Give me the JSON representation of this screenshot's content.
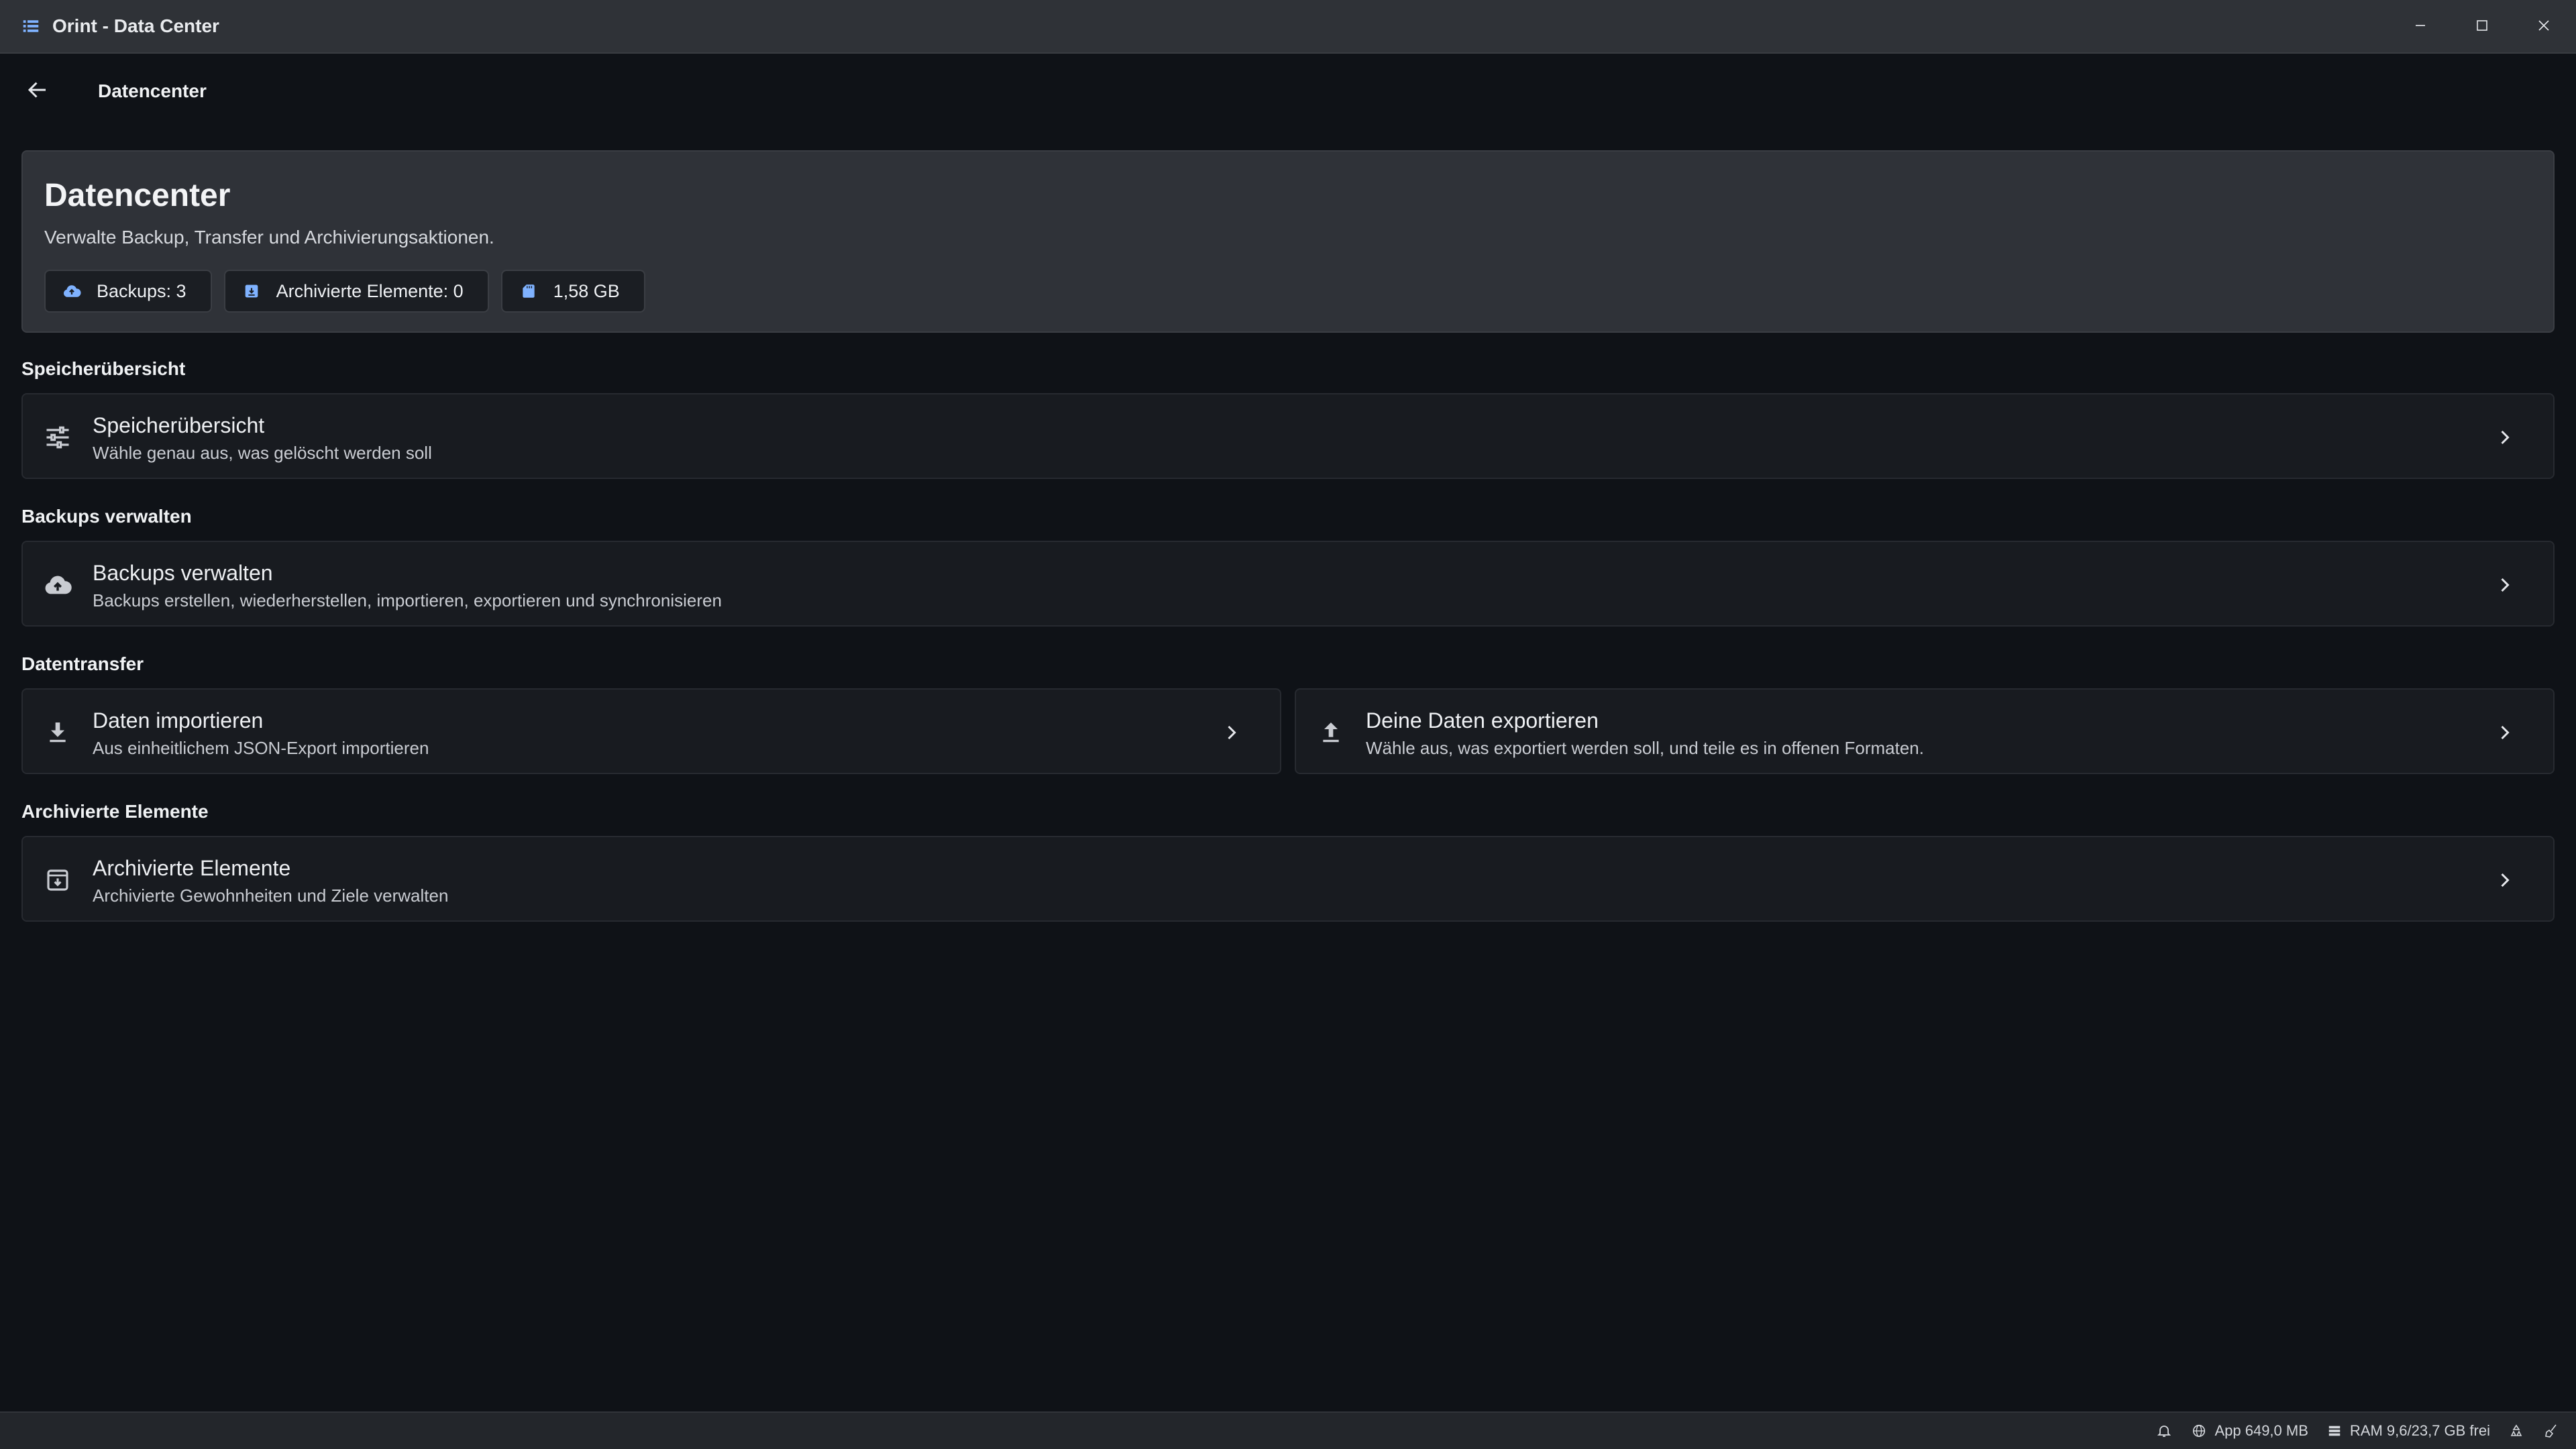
{
  "window": {
    "title": "Orint - Data Center",
    "icons": {
      "app": "list-icon",
      "minimize": "minimize-icon",
      "maximize": "maximize-icon",
      "close": "close-icon"
    }
  },
  "header": {
    "title": "Datencenter",
    "back_icon": "arrow-left-icon"
  },
  "hero": {
    "title": "Datencenter",
    "subtitle": "Verwalte Backup, Transfer und Archivierungsaktionen.",
    "chips": [
      {
        "icon": "cloud-upload-icon",
        "label": "Backups: 3"
      },
      {
        "icon": "archive-icon",
        "label": "Archivierte Elemente: 0"
      },
      {
        "icon": "sd-card-icon",
        "label": "1,58 GB"
      }
    ]
  },
  "sections": {
    "storage": {
      "label": "Speicherübersicht",
      "card": {
        "icon": "sliders-icon",
        "title": "Speicherübersicht",
        "subtitle": "Wähle genau aus, was gelöscht werden soll"
      }
    },
    "backups": {
      "label": "Backups verwalten",
      "card": {
        "icon": "cloud-upload-icon",
        "title": "Backups verwalten",
        "subtitle": "Backups erstellen, wiederherstellen, importieren, exportieren und synchronisieren"
      }
    },
    "transfer": {
      "label": "Datentransfer",
      "import": {
        "icon": "download-icon",
        "title": "Daten importieren",
        "subtitle": "Aus einheitlichem JSON-Export importieren"
      },
      "export": {
        "icon": "upload-icon",
        "title": "Deine Daten exportieren",
        "subtitle": "Wähle aus, was exportiert werden soll, und teile es in offenen Formaten."
      }
    },
    "archived": {
      "label": "Archivierte Elemente",
      "card": {
        "icon": "archive-icon",
        "title": "Archivierte Elemente",
        "subtitle": "Archivierte Gewohnheiten und Ziele verwalten"
      }
    }
  },
  "statusbar": {
    "app_mem": "App 649,0 MB",
    "ram": "RAM 9,6/23,7 GB frei",
    "icons": [
      "bell-icon",
      "globe-icon",
      "server-icon",
      "recycle-icon",
      "broom-icon"
    ]
  },
  "colors": {
    "background": "#0f1217",
    "titlebar": "#2f3237",
    "hero": "#2f3238",
    "card": "#181b20",
    "chip_icon": "#7fb2ff"
  }
}
